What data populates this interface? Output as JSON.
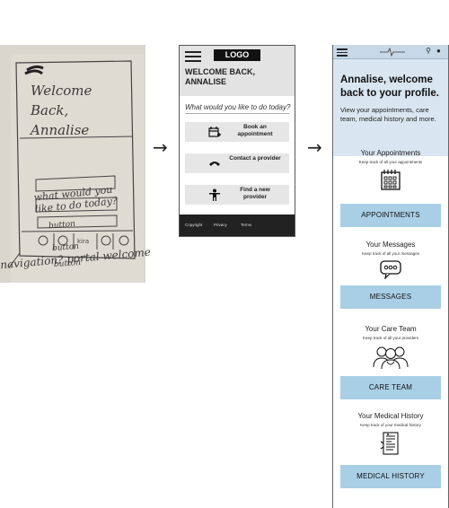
{
  "sketch": {
    "welcome": "Welcome Back, Annalise",
    "question": "what would you like to do today?",
    "buttons": [
      "button",
      "button",
      "button"
    ],
    "caption": "navigation? portal welcome"
  },
  "arrows": {
    "glyph": "→"
  },
  "wireframe": {
    "logo": "LOGO",
    "welcome": "WELCOME BACK, ANNALISE",
    "question": "What would you like to do today?",
    "buttons": [
      {
        "label": "Book an appointment",
        "icon": "calendar-plus-icon"
      },
      {
        "label": "Contact a provider",
        "icon": "phone-icon"
      },
      {
        "label": "Find a new provider",
        "icon": "person-icon"
      }
    ],
    "footer": {
      "copyright": "Copyright",
      "privacy": "Privacy",
      "terms": "Terms"
    }
  },
  "final": {
    "colors": {
      "bar": "#c7d9e8",
      "hero": "#d9e6f1",
      "button": "#a9cfe6"
    },
    "hero_title": "Annalise, welcome back to your profile.",
    "hero_sub": "View your appointments, care team, medical history and more.",
    "sections": [
      {
        "title": "Your Appointments",
        "sub": "Keep track of all your appointments",
        "button": "APPOINTMENTS",
        "icon": "calendar-icon"
      },
      {
        "title": "Your Messages",
        "sub": "Keep track of all your messages",
        "button": "MESSAGES",
        "icon": "chat-bubble-icon"
      },
      {
        "title": "Your Care Team",
        "sub": "Keep track of all your providers",
        "button": "CARE TEAM",
        "icon": "care-team-icon"
      },
      {
        "title": "Your Medical History",
        "sub": "Keep track of your medical history",
        "button": "MEDICAL HISTORY",
        "icon": "medical-record-icon"
      }
    ]
  }
}
